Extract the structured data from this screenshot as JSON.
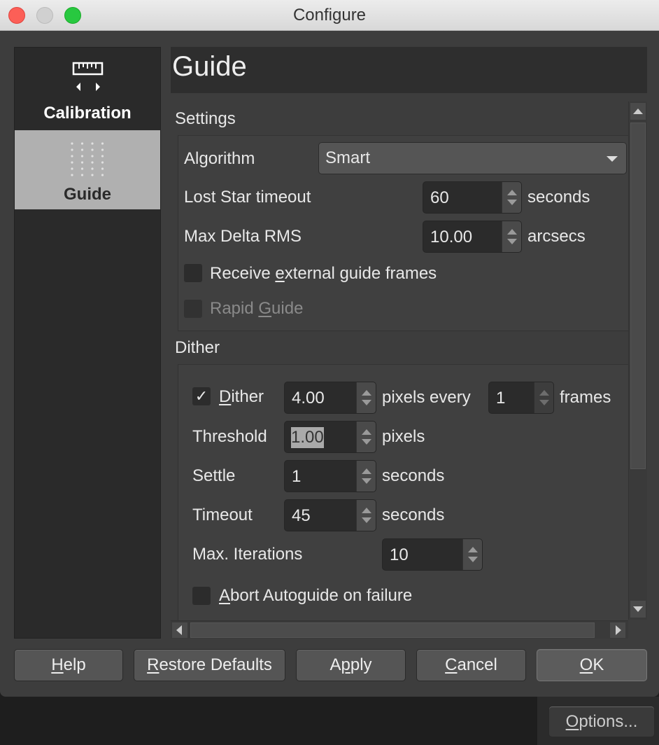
{
  "window": {
    "title": "Configure"
  },
  "sidebar": {
    "items": [
      {
        "label": "Calibration",
        "icon": "ruler-icon",
        "selected": false
      },
      {
        "label": "Guide",
        "icon": "dots-grid-icon",
        "selected": true
      }
    ]
  },
  "header": {
    "title": "Guide"
  },
  "settings": {
    "title": "Settings",
    "algorithm": {
      "label": "Algorithm",
      "value": "Smart"
    },
    "lost_star_timeout": {
      "label": "Lost Star timeout",
      "value": "60",
      "unit": "seconds"
    },
    "max_delta_rms": {
      "label": "Max Delta RMS",
      "value": "10.00",
      "unit": "arcsecs"
    },
    "receive_external": {
      "label": "Receive external guide frames",
      "checked": false
    },
    "rapid_guide": {
      "label": "Rapid Guide",
      "checked": false,
      "enabled": false
    }
  },
  "dither": {
    "title": "Dither",
    "dither": {
      "label": "Dither",
      "checked": true,
      "value": "4.00",
      "unit": "pixels every",
      "frames_value": "1",
      "frames_unit": "frames"
    },
    "threshold": {
      "label": "Threshold",
      "value": "1.00",
      "unit": "pixels"
    },
    "settle": {
      "label": "Settle",
      "value": "1",
      "unit": "seconds"
    },
    "timeout": {
      "label": "Timeout",
      "value": "45",
      "unit": "seconds"
    },
    "max_iterations": {
      "label": "Max. Iterations",
      "value": "10"
    },
    "abort": {
      "label": "Abort Autoguide on failure",
      "checked": false
    }
  },
  "buttons": {
    "help": "Help",
    "restore": "Restore Defaults",
    "apply": "Apply",
    "cancel": "Cancel",
    "ok": "OK"
  },
  "background": {
    "options": "Options..."
  },
  "colors": {
    "close": "#fc5f57",
    "minimize": "#d0d0d0",
    "maximize": "#28c840",
    "selected_sidebar": "#b0b0b0"
  }
}
